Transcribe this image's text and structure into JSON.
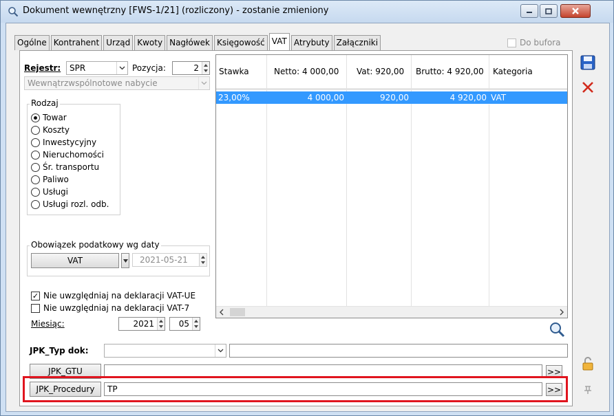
{
  "window": {
    "title": "Dokument wewnętrzny [FWS-1/21] (rozliczony) - zostanie zmieniony"
  },
  "tabs": [
    "Ogólne",
    "Kontrahent",
    "Urząd",
    "Kwoty",
    "Nagłówek",
    "Księgowość",
    "VAT",
    "Atrybuty",
    "Załączniki"
  ],
  "active_tab": "VAT",
  "do_bufora": {
    "label": "Do bufora",
    "checked": false
  },
  "rejestr": {
    "label": "Rejestr:",
    "value": "SPR"
  },
  "pozycja": {
    "label": "Pozycja:",
    "value": "2"
  },
  "transaction_type": "Wewnątrzwspólnotowe nabycie",
  "rodzaj": {
    "title": "Rodzaj",
    "options": [
      "Towar",
      "Koszty",
      "Inwestycyjny",
      "Nieruchomości",
      "Śr. transportu",
      "Paliwo",
      "Usługi",
      "Usługi rozl. odb."
    ],
    "selected": "Towar"
  },
  "obowiazek": {
    "title": "Obowiązek podatkowy wg daty",
    "type": "VAT",
    "date": "2021-05-21"
  },
  "checks": [
    {
      "label": "Nie uwzględniaj na deklaracji VAT-UE",
      "checked": true
    },
    {
      "label": "Nie uwzględniaj na deklaracji VAT-7",
      "checked": false
    }
  ],
  "miesiac": {
    "label": "Miesiąc:",
    "year": "2021",
    "month": "05"
  },
  "grid": {
    "headers": [
      "Stawka",
      "Netto: 4 000,00",
      "Vat: 920,00",
      "Brutto: 4 920,00",
      "Kategoria"
    ],
    "rows": [
      {
        "stawka": "23,00%",
        "netto": "4 000,00",
        "vat": "920,00",
        "brutto": "4 920,00",
        "kategoria": "VAT"
      }
    ]
  },
  "jpk": {
    "typ_label": "JPK_Typ dok:",
    "typ_value": "",
    "gtu_label": "JPK_GTU",
    "gtu_value": "",
    "procedury_label": "JPK_Procedury",
    "procedury_value": "TP",
    "more_label": ">>"
  },
  "colors": {
    "selection": "#3399ff",
    "highlight": "#e0141e",
    "save": "#2a63c6",
    "delete": "#d22b1d"
  }
}
